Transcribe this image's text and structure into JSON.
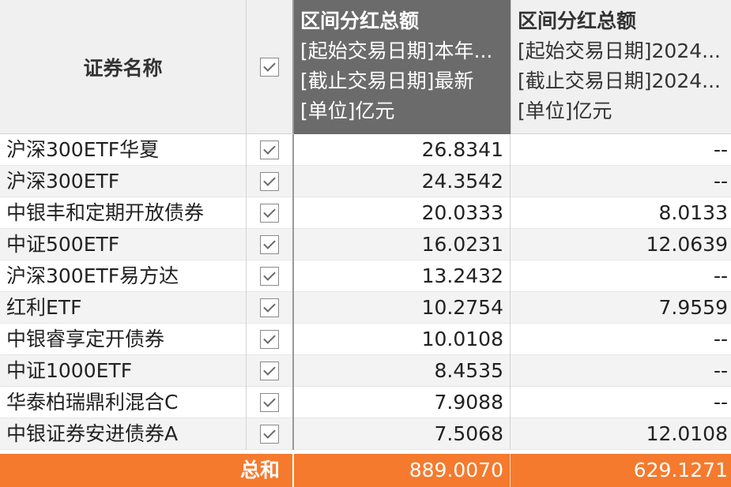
{
  "header": {
    "name_col": "证券名称",
    "col1": {
      "title": "区间分红总额",
      "start": "[起始交易日期]本年...",
      "end": "[截止交易日期]最新",
      "unit": "[单位]亿元"
    },
    "col2": {
      "title": "区间分红总额",
      "start": "[起始交易日期]2024...",
      "end": "[截止交易日期]2024...",
      "unit": "[单位]亿元"
    }
  },
  "rows": [
    {
      "name": "沪深300ETF华夏",
      "v1": "26.8341",
      "v2": "--"
    },
    {
      "name": "沪深300ETF",
      "v1": "24.3542",
      "v2": "--"
    },
    {
      "name": "中银丰和定期开放债券",
      "v1": "20.0333",
      "v2": "8.0133"
    },
    {
      "name": "中证500ETF",
      "v1": "16.0231",
      "v2": "12.0639"
    },
    {
      "name": "沪深300ETF易方达",
      "v1": "13.2432",
      "v2": "--"
    },
    {
      "name": "红利ETF",
      "v1": "10.2754",
      "v2": "7.9559"
    },
    {
      "name": "中银睿享定开债券",
      "v1": "10.0108",
      "v2": "--"
    },
    {
      "name": "中证1000ETF",
      "v1": "8.4535",
      "v2": "--"
    },
    {
      "name": "华泰柏瑞鼎利混合C",
      "v1": "7.9088",
      "v2": "--"
    },
    {
      "name": "中银证券安进债券A",
      "v1": "7.5068",
      "v2": "12.0108"
    }
  ],
  "footer": {
    "label": "总和",
    "v1": "889.0070",
    "v2": "629.1271"
  },
  "colors": {
    "selected_header": "#6b6b6b",
    "footer": "#f57a2e"
  }
}
